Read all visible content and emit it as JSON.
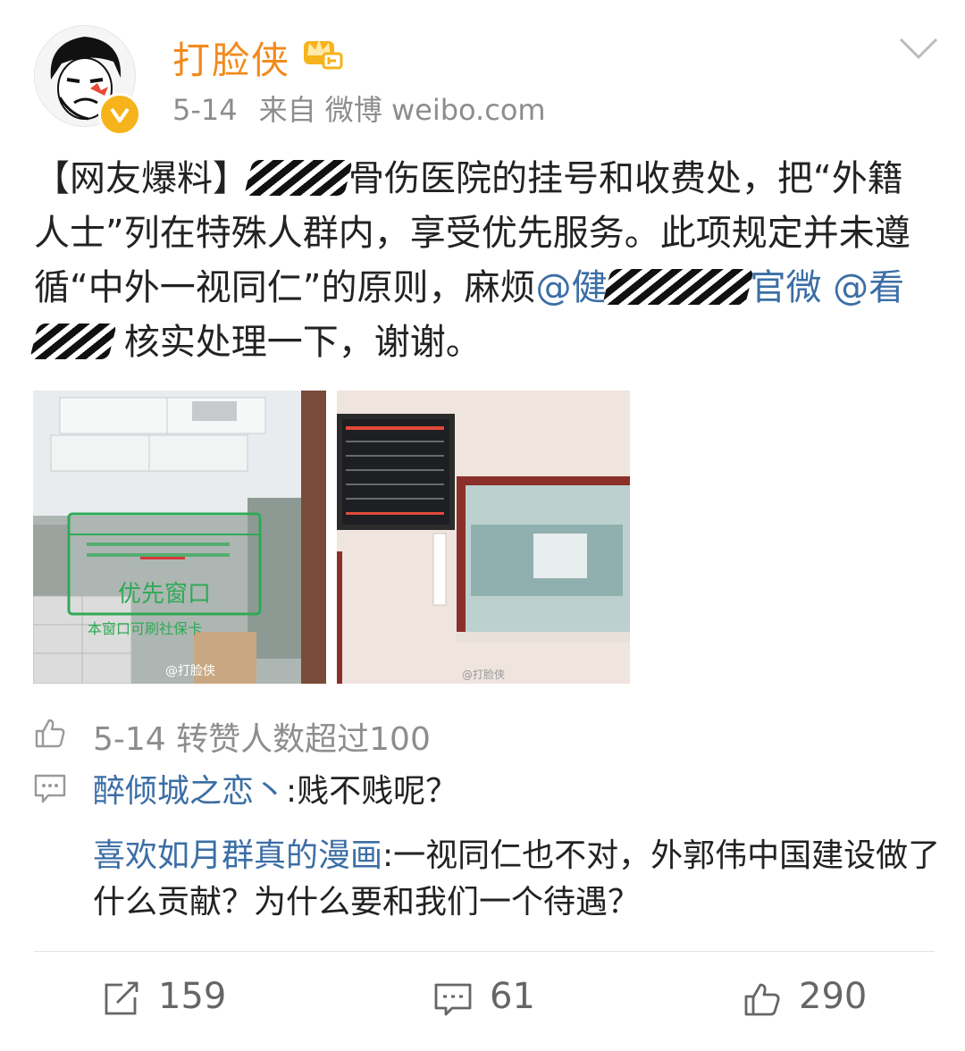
{
  "user": {
    "name": "打脸侠",
    "date": "5-14",
    "source": "来自 微博 weibo.com"
  },
  "post": {
    "line_parts": {
      "prefix": "【网友爆料】",
      "after_blur1": "骨伤医院的挂号和收费处，把“外籍人士”列在特殊人群内，享受优先服务。此项规定并未遵循“中外一视同仁”的原则，麻烦",
      "mention1": "@健",
      "mention1_tail": "官微",
      "mention2": "@看",
      "tail": " 核实处理一下，谢谢。"
    }
  },
  "images": {
    "photo1_sign_title": "优先窗口",
    "photo1_sign_sub": "本窗口可刷社保卡",
    "photo1_watermark": "@打脸侠",
    "photo2_watermark": "@打脸侠"
  },
  "likes": {
    "text": "5-14 转赞人数超过100"
  },
  "comments": [
    {
      "author": "醉倾城之恋丶",
      "text": ":贱不贱呢？"
    },
    {
      "author": "喜欢如月群真的漫画",
      "text": ":一视同仁也不对，外郭伟中国建设做了什么贡献？为什么要和我们一个待遇？"
    }
  ],
  "actions": {
    "repost_count": "159",
    "comment_count": "61",
    "like_count": "290"
  },
  "colors": {
    "username": "#f28a1c",
    "mention": "#3b6ea5",
    "meta": "#8d8d8d",
    "verified": "#f6b31b"
  },
  "icons": [
    "verified-icon",
    "crown-icon",
    "chevron-down-icon",
    "thumb-up-icon",
    "comment-icon",
    "repost-icon"
  ]
}
